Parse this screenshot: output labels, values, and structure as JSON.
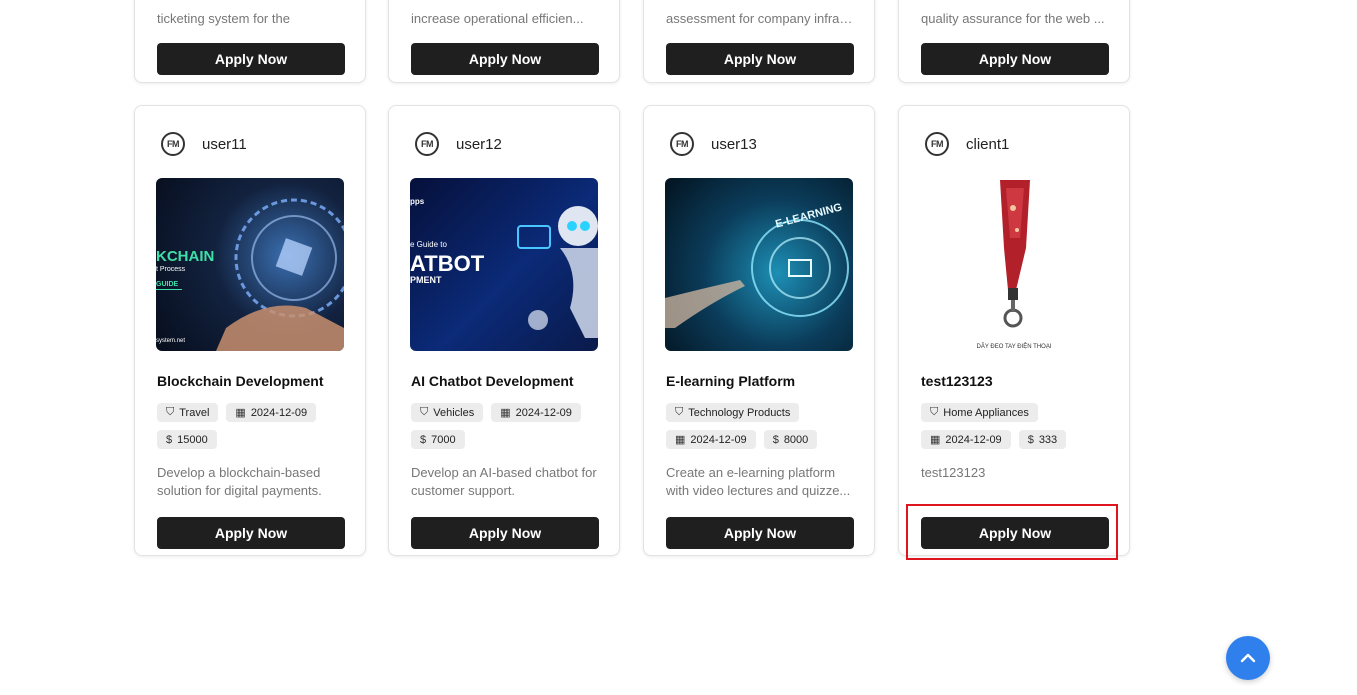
{
  "top_cards": [
    {
      "desc": "ticketing system for the",
      "button": "Apply Now"
    },
    {
      "desc": "increase operational efficien...",
      "button": "Apply Now"
    },
    {
      "desc": "assessment for company infrastr...",
      "button": "Apply Now"
    },
    {
      "desc": "quality assurance for the web ...",
      "button": "Apply Now"
    }
  ],
  "cards": [
    {
      "user": "user11",
      "avatar": "FM",
      "title": "Blockchain Development",
      "category": "Travel",
      "date": "2024-12-09",
      "budget": "15000",
      "desc": "Develop a blockchain-based solution for digital payments.",
      "button": "Apply Now",
      "image": {
        "line1": "KCHAIN",
        "line2": "t Process",
        "line3": "GUIDE",
        "line4": "system.net"
      }
    },
    {
      "user": "user12",
      "avatar": "FM",
      "title": "AI Chatbot Development",
      "category": "Vehicles",
      "date": "2024-12-09",
      "budget": "7000",
      "desc": "Develop an AI-based chatbot for customer support.",
      "button": "Apply Now",
      "image": {
        "line1": "pps",
        "line2": "e Guide to",
        "line3": "ATBOT",
        "line4": "PMENT"
      }
    },
    {
      "user": "user13",
      "avatar": "FM",
      "title": "E-learning Platform",
      "category": "Technology Products",
      "date": "2024-12-09",
      "budget": "8000",
      "desc": "Create an e-learning platform with video lectures and quizze...",
      "button": "Apply Now",
      "image": {
        "line1": "E-LEARNING"
      }
    },
    {
      "user": "client1",
      "avatar": "FM",
      "title": "test123123",
      "category": "Home Appliances",
      "date": "2024-12-09",
      "budget": "333",
      "desc": "test123123",
      "button": "Apply Now",
      "image": {
        "line1": "DÂY ĐEO TAY ĐIỆN THOẠI"
      }
    }
  ],
  "icons": {
    "tag": "tag-icon",
    "calendar": "calendar-icon",
    "dollar": "dollar-icon",
    "scroll": "chevron-up-icon"
  },
  "colors": {
    "button": "#1f1f1f",
    "scroll_button": "#2f80ed",
    "highlight": "#e0141e"
  }
}
